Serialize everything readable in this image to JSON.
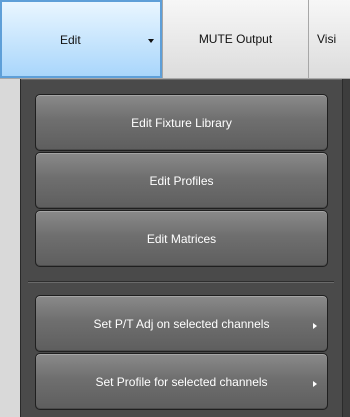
{
  "toolbar": {
    "edit_label": "Edit",
    "mute_label": "MUTE Output",
    "next_label": "Visi"
  },
  "menu": {
    "items": [
      {
        "label": "Edit Fixture Library"
      },
      {
        "label": "Edit Profiles"
      },
      {
        "label": "Edit Matrices"
      },
      {
        "label": "Set P/T Adj on selected channels"
      },
      {
        "label": "Set Profile for selected channels"
      }
    ]
  },
  "colors": {
    "menu_bg": "#4a4a4a",
    "menu_button": "#6f6f6f",
    "active_tab": "#a9d6fb",
    "active_tab_border": "#5e9fd8"
  }
}
